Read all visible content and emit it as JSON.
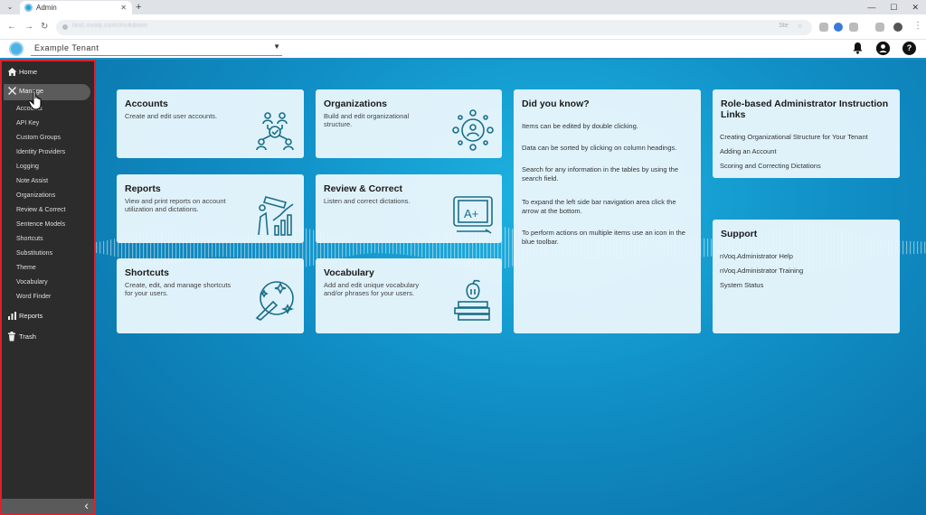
{
  "browser": {
    "tab_title": "Admin",
    "tab_close": "✕",
    "new_tab": "+",
    "win_min": "—",
    "win_max": "☐",
    "win_close": "✕",
    "url_text": "test.nvoq.com/nvAdmin",
    "url_right_a": "Ste",
    "url_right_b": "☆"
  },
  "appbar": {
    "tenant": "Example Tenant"
  },
  "sidebar": {
    "items": [
      {
        "label": "Home",
        "icon": "home-icon"
      },
      {
        "label": "Manage",
        "icon": "wrench-icon"
      }
    ],
    "manage_sub": [
      "Accounts",
      "API Key",
      "Custom Groups",
      "Identity Providers",
      "Logging",
      "Note Assist",
      "Organizations",
      "Review & Correct",
      "Sentence Models",
      "Shortcuts",
      "Substitutions",
      "Theme",
      "Vocabulary",
      "Word Finder"
    ],
    "bottom": [
      {
        "label": "Reports",
        "icon": "chart-icon"
      },
      {
        "label": "Trash",
        "icon": "trash-icon"
      }
    ],
    "collapse_glyph": "‹"
  },
  "cards": {
    "accounts": {
      "title": "Accounts",
      "desc": "Create and edit user accounts."
    },
    "organizations": {
      "title": "Organizations",
      "desc": "Build and edit organizational structure."
    },
    "reports": {
      "title": "Reports",
      "desc": "View and print reports on account utilization and dictations."
    },
    "review": {
      "title": "Review & Correct",
      "desc": "Listen and correct dictations."
    },
    "shortcuts": {
      "title": "Shortcuts",
      "desc": "Create, edit, and manage shortcuts for your users."
    },
    "vocabulary": {
      "title": "Vocabulary",
      "desc": "Add and edit unique vocabulary and/or phrases for your users."
    }
  },
  "did_you_know": {
    "title": "Did you know?",
    "tips": [
      "Items can be edited by double clicking.",
      "Data can be sorted by clicking on column headings.",
      "Search for any information in the tables by using the search field.",
      "To expand the left side bar navigation area click the arrow at the bottom.",
      "To perform actions on multiple items use an icon in the blue toolbar."
    ]
  },
  "instruction": {
    "title": "Role-based Administrator Instruction Links",
    "links": [
      "Creating Organizational Structure for Your Tenant",
      "Adding an Account",
      "Scoring and Correcting Dictations"
    ]
  },
  "support": {
    "title": "Support",
    "links": [
      "nVoq.Administrator Help",
      "nVoq.Administrator Training",
      "System Status"
    ]
  },
  "colors": {
    "accent": "#1e8cc0",
    "highlight_box": "#e0202a",
    "sidebar_bg": "#2c2c2c"
  }
}
